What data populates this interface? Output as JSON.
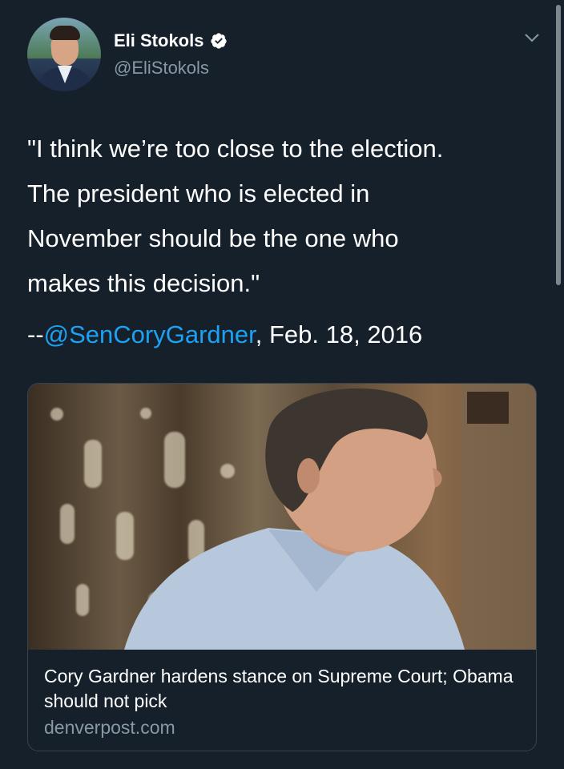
{
  "tweet": {
    "author": {
      "name": "Eli Stokols",
      "handle": "@EliStokols",
      "verified": true
    },
    "menu_icon": "chevron-down-icon",
    "text_lines": [
      "\"I think we’re too close to the election.",
      "The president who is elected in",
      "November should be the one who",
      "makes this decision.\""
    ],
    "attribution": {
      "prefix": "--",
      "mention": "@SenCoryGardner",
      "suffix": ", Feb. 18, 2016"
    }
  },
  "card": {
    "title": "Cory Gardner hardens stance on Supreme Court; Obama should not pick",
    "domain": "denverpost.com"
  },
  "colors": {
    "background": "#15202b",
    "link": "#1da1f2",
    "muted": "#8899a6",
    "border": "#38444d"
  }
}
